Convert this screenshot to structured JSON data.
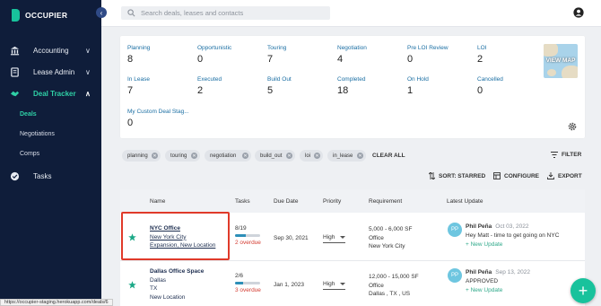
{
  "app": {
    "name": "OCCUPIER"
  },
  "sidebar": {
    "items": [
      {
        "label": "Accounting",
        "icon": "bank-icon"
      },
      {
        "label": "Lease Admin",
        "icon": "document-icon"
      },
      {
        "label": "Deal Tracker",
        "icon": "handshake-icon",
        "active": true
      },
      {
        "label": "Tasks",
        "icon": "check-circle-icon"
      }
    ],
    "sub_items": [
      {
        "label": "Deals",
        "active": true
      },
      {
        "label": "Negotiations"
      },
      {
        "label": "Comps"
      }
    ]
  },
  "search": {
    "placeholder": "Search deals, leases and contacts"
  },
  "stats": [
    {
      "label": "Planning",
      "value": "8"
    },
    {
      "label": "Opportunistic",
      "value": "0"
    },
    {
      "label": "Touring",
      "value": "7"
    },
    {
      "label": "Negotiation",
      "value": "4"
    },
    {
      "label": "Pre LOI Review",
      "value": "0"
    },
    {
      "label": "LOI",
      "value": "2"
    },
    {
      "label": "In Lease",
      "value": "7"
    },
    {
      "label": "Executed",
      "value": "2"
    },
    {
      "label": "Build Out",
      "value": "5"
    },
    {
      "label": "Completed",
      "value": "18"
    },
    {
      "label": "On Hold",
      "value": "1"
    },
    {
      "label": "Cancelled",
      "value": "0"
    },
    {
      "label": "My Custom Deal Stag...",
      "value": "0"
    }
  ],
  "map": {
    "label": "VIEW MAP"
  },
  "filters": {
    "chips": [
      "planning",
      "touring",
      "negotiation",
      "build_out",
      "loi",
      "in_lease"
    ],
    "clear_all": "CLEAR ALL",
    "filter_label": "FILTER"
  },
  "toolbar": {
    "sort": "SORT: STARRED",
    "configure": "CONFIGURE",
    "export": "EXPORT"
  },
  "table": {
    "headers": [
      "Name",
      "Tasks",
      "Due Date",
      "Priority",
      "Requirement",
      "Latest Update"
    ],
    "rows": [
      {
        "title": "NYC Office",
        "line2": "New York City",
        "line3": "Expansion, New Location",
        "tasks": "8/19",
        "progress": 0.42,
        "overdue": "2 overdue",
        "due": "Sep 30, 2021",
        "priority": "High",
        "req1": "5,000 - 6,000 SF",
        "req2": "Office",
        "req3": "New York City",
        "avatar": "PP",
        "who": "Phil Peña",
        "when": "Oct 03, 2022",
        "message": "Hey Matt - time to get going on NYC",
        "new_update": "+ New Update"
      },
      {
        "title": "Dallas Office Space",
        "line2": "Dallas",
        "line3": "TX",
        "line4": "New Location",
        "tasks": "2/6",
        "progress": 0.33,
        "overdue": "3 overdue",
        "due": "Jan 1, 2023",
        "priority": "High",
        "req1": "12,000 - 15,000 SF",
        "req2": "Office",
        "req3": "Dallas , TX , US",
        "avatar": "PP",
        "who": "Phil Peña",
        "when": "Sep 13, 2022",
        "message": "APPROVED",
        "new_update": "+ New Update"
      }
    ]
  },
  "status_url": "https://occupier-staging.herokuapp.com/deals/6",
  "colors": {
    "sidebar": "#0f1d3a",
    "accent": "#18c29c",
    "highlight": "#e03a2a",
    "overdue": "#d33b30"
  }
}
